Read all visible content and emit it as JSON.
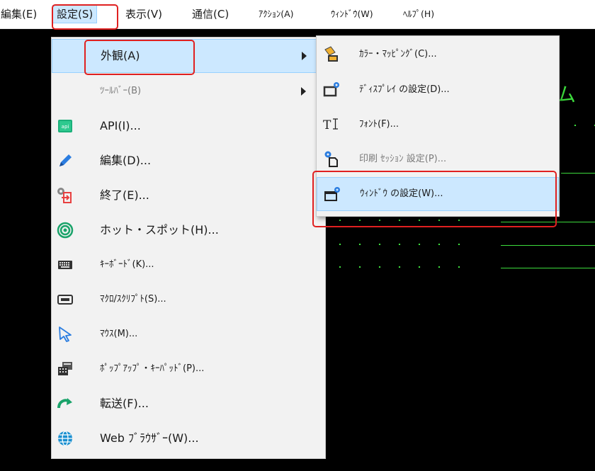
{
  "menubar": {
    "items": [
      {
        "label": "編集(E)"
      },
      {
        "label": "設定(S)"
      },
      {
        "label": "表示(V)"
      },
      {
        "label": "通信(C)"
      },
      {
        "label": "ｱｸｼｮﾝ(A)"
      },
      {
        "label": "ｳｨﾝﾄﾞｳ(W)"
      },
      {
        "label": "ﾍﾙﾌﾟ(H)"
      }
    ]
  },
  "settings_menu": {
    "items": [
      {
        "label": "外観(A)",
        "icon": "none"
      },
      {
        "label": "ﾂｰﾙﾊﾞｰ(B)",
        "icon": "none"
      },
      {
        "label": "API(I)...",
        "icon": "api-icon"
      },
      {
        "label": "編集(D)...",
        "icon": "pencil-icon"
      },
      {
        "label": "終了(E)...",
        "icon": "exit-gear-icon"
      },
      {
        "label": "ホット・スポット(H)...",
        "icon": "target-icon"
      },
      {
        "label": "ｷｰﾎﾞｰﾄﾞ(K)...",
        "icon": "keyboard-icon"
      },
      {
        "label": "ﾏｸﾛ/ｽｸﾘﾌﾟﾄ(S)...",
        "icon": "macro-icon"
      },
      {
        "label": "ﾏｳｽ(M)...",
        "icon": "mouse-cursor-icon"
      },
      {
        "label": "ﾎﾟｯﾌﾟｱｯﾌﾟ・ｷｰﾊﾟｯﾄﾞ(P)...",
        "icon": "popup-keypad-icon"
      },
      {
        "label": "転送(F)...",
        "icon": "transfer-arrow-icon"
      },
      {
        "label": "Web ﾌﾞﾗｳｻﾞｰ(W)...",
        "icon": "globe-icon"
      }
    ]
  },
  "appearance_submenu": {
    "items": [
      {
        "label": "ｶﾗｰ・ﾏｯﾋﾟﾝｸﾞ(C)...",
        "icon": "color-bucket-icon"
      },
      {
        "label": "ﾃﾞｨｽﾌﾟﾚｲ の設定(D)...",
        "icon": "display-gear-icon"
      },
      {
        "label": "ﾌｫﾝﾄ(F)...",
        "icon": "font-icon"
      },
      {
        "label": "印刷 ｾｯｼｮﾝ 設定(P)...",
        "icon": "print-gear-icon"
      },
      {
        "label": "ｳｨﾝﾄﾞｳ の設定(W)...",
        "icon": "window-gear-icon"
      }
    ]
  },
  "terminal": {
    "text_top": "ム",
    "colors": {
      "text": "#3ddc3d"
    }
  },
  "colors": {
    "menu_bg": "#f2f2f2",
    "highlight_bg": "#cce8ff",
    "highlight_border": "#99d1ff",
    "annotation_red": "#e02020"
  }
}
